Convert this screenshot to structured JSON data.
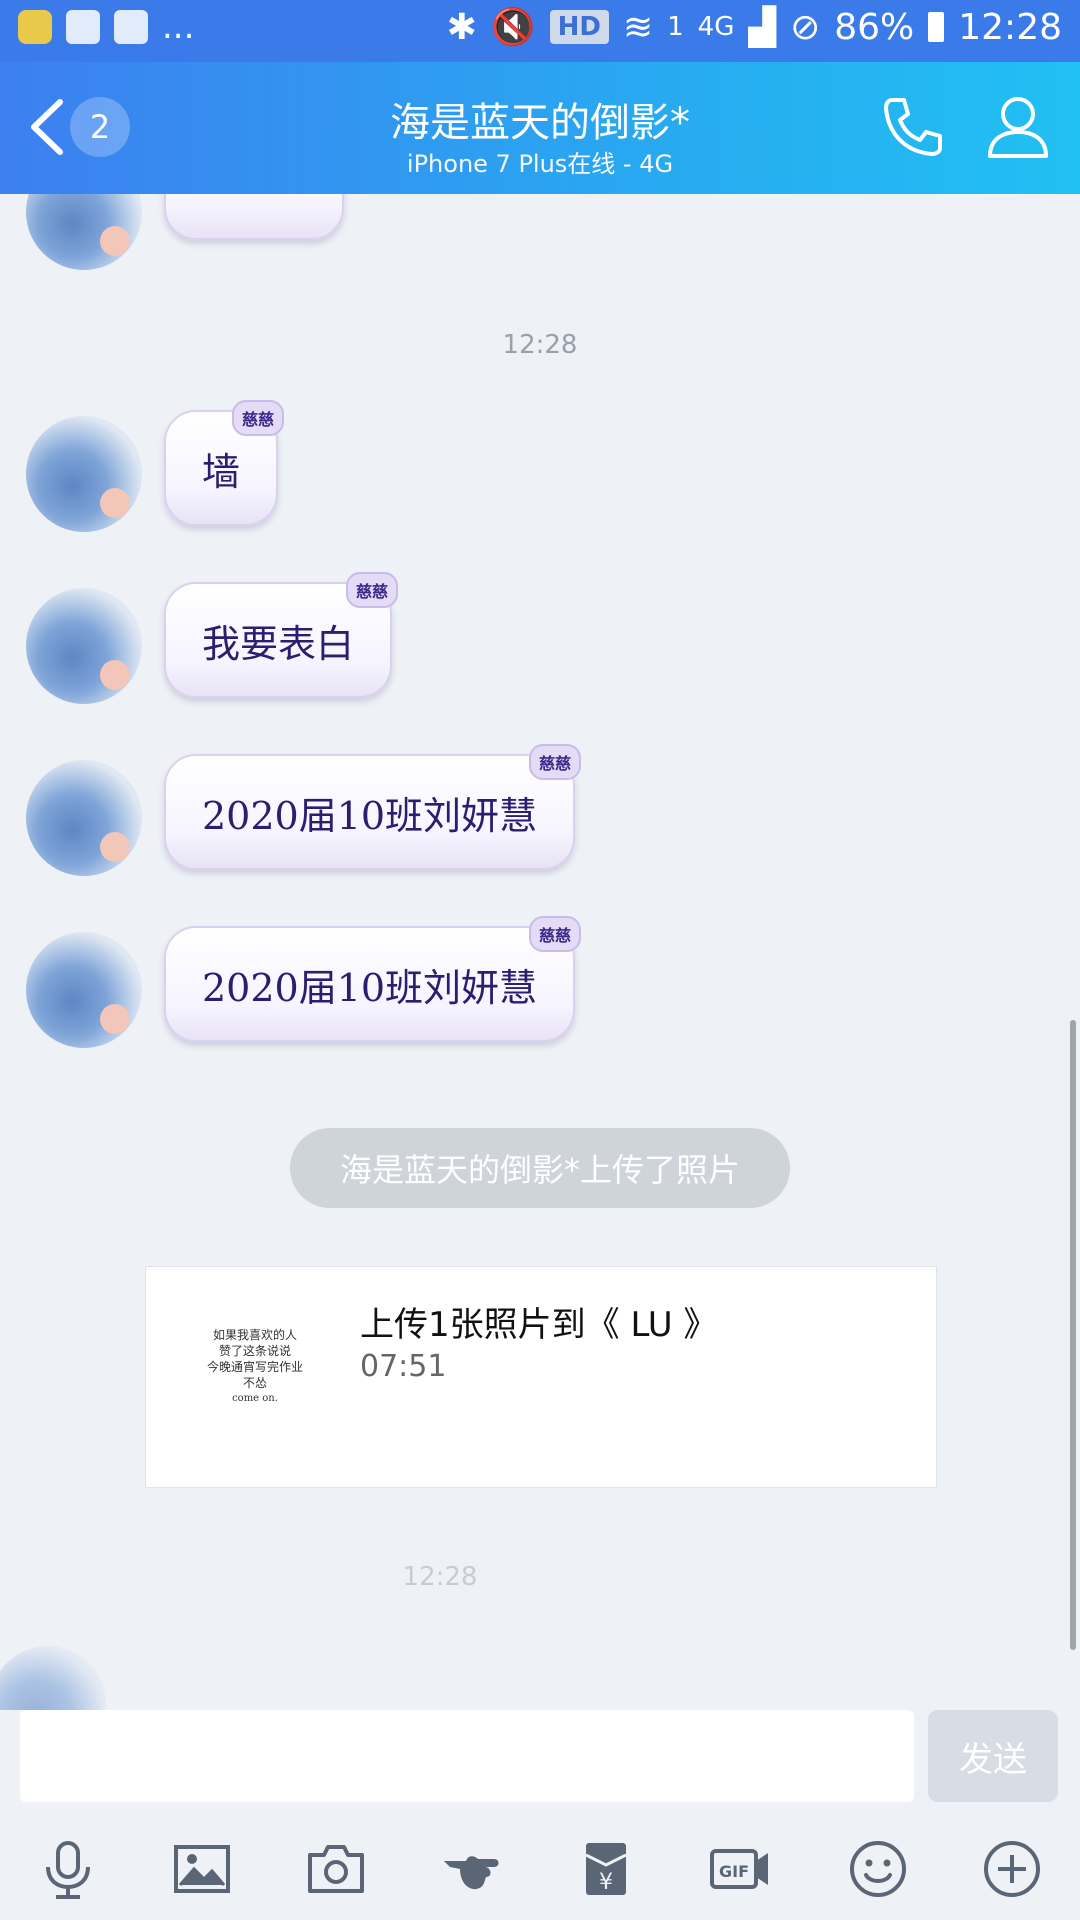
{
  "status_bar": {
    "more": "...",
    "network_type": "4G",
    "sim": "1",
    "hd": "HD",
    "battery": "86%",
    "time": "12:28"
  },
  "header": {
    "unread_count": "2",
    "title": "海是蓝天的倒影*",
    "subtitle": "iPhone 7 Plus在线 - 4G"
  },
  "chat": {
    "timestamp_1": "12:28",
    "bubble_tag": "慈慈",
    "messages": [
      {
        "text": "墙"
      },
      {
        "text": "我要表白"
      },
      {
        "text": "2020届10班刘妍慧"
      },
      {
        "text": "2020届10班刘妍慧"
      }
    ],
    "system_notice": "海是蓝天的倒影*上传了照片",
    "photo_card": {
      "title": "上传1张照片到《 LU 》",
      "time": "07:51",
      "thumb_lines": [
        "如果我喜欢的人",
        "赞了这条说说",
        "今晚通宵写完作业",
        "不怂",
        "come on."
      ]
    },
    "timestamp_2": "12:28"
  },
  "input": {
    "value": "",
    "send_label": "发送"
  },
  "toolbar": {
    "icons": [
      "microphone-icon",
      "image-icon",
      "camera-icon",
      "poke-icon",
      "red-packet-icon",
      "gif-icon",
      "emoji-icon",
      "plus-icon"
    ]
  },
  "colors": {
    "header_start": "#3d7ff0",
    "header_end": "#21c0f2",
    "bubble_text": "#2b1e6e",
    "background": "#eef1f6"
  }
}
